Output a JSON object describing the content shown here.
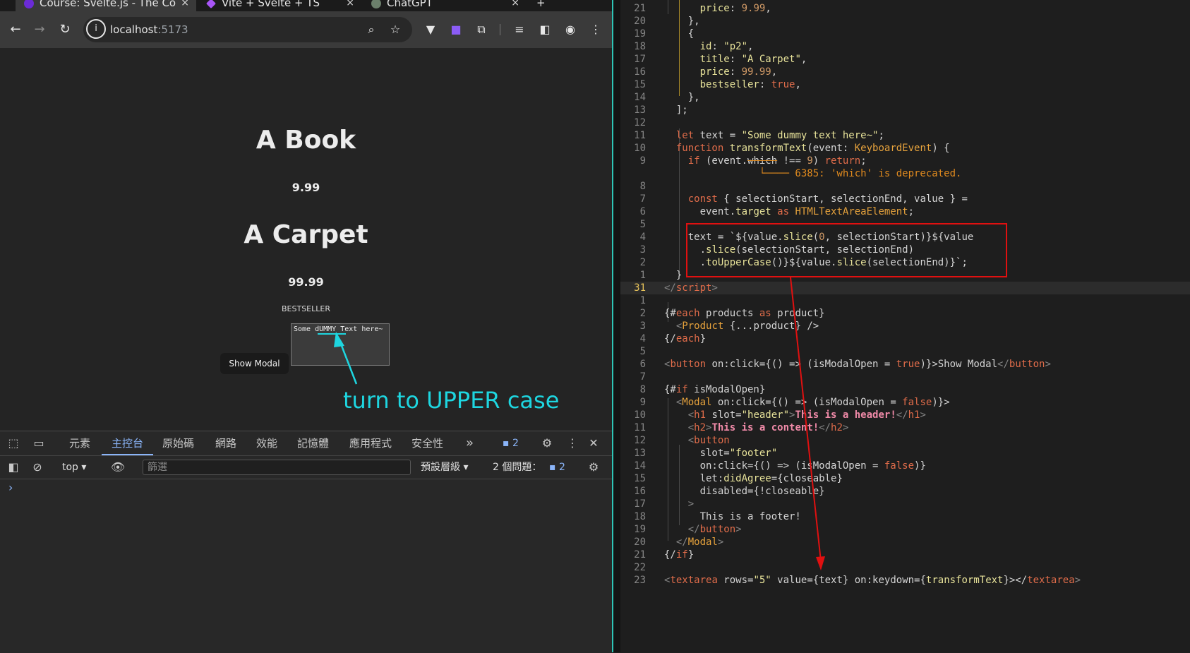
{
  "browser": {
    "tabs": [
      {
        "title": "Course: Svelte.js - The Co",
        "active": true,
        "favicon_color": "#6b2bd6"
      },
      {
        "title": "Vite + Svelte + TS",
        "active": false,
        "favicon_color": "#a855f7"
      },
      {
        "title": "ChatGPT",
        "active": false,
        "favicon_color": "#6b7f6b"
      }
    ],
    "close_glyph": "×",
    "new_tab_glyph": "+",
    "url_host": "localhost",
    "url_port": ":5173",
    "info_glyph": "i"
  },
  "page": {
    "products": [
      {
        "title": "A Book",
        "price": "9.99"
      },
      {
        "title": "A Carpet",
        "price": "99.99",
        "badge": "BESTSELLER"
      }
    ],
    "textarea_value": "Some dUMMY Text here~",
    "show_modal_label": "Show Modal",
    "annotation": "turn to UPPER case",
    "annotation_color": "#1ed6e0"
  },
  "devtools": {
    "tabs": [
      "元素",
      "主控台",
      "原始碼",
      "網路",
      "效能",
      "記憶體",
      "應用程式",
      "安全性"
    ],
    "active_tab": "主控台",
    "more_glyph": "»",
    "issues_badge": "2",
    "context": "top",
    "filter_placeholder": "篩選",
    "levels": "預設層級",
    "issues_label": "2 個問題：",
    "issues_count": "2",
    "prompt": "›"
  },
  "editor": {
    "highlight_box_color": "#e01010",
    "lines": [
      {
        "n": "21",
        "segs": [
          [
            "      ",
            "#d4d4d4"
          ],
          [
            "price",
            "#e8e39a"
          ],
          [
            ": ",
            "#d4d4d4"
          ],
          [
            "9.99",
            "#d19a66"
          ],
          [
            ",",
            "#d4d4d4"
          ]
        ]
      },
      {
        "n": "20",
        "segs": [
          [
            "    },",
            "#d4d4d4"
          ]
        ]
      },
      {
        "n": "19",
        "segs": [
          [
            "    {",
            "#d4d4d4"
          ]
        ]
      },
      {
        "n": "18",
        "segs": [
          [
            "      ",
            "#d4d4d4"
          ],
          [
            "id",
            "#e8e39a"
          ],
          [
            ": ",
            "#d4d4d4"
          ],
          [
            "\"p2\"",
            "#e8e39a"
          ],
          [
            ",",
            "#d4d4d4"
          ]
        ]
      },
      {
        "n": "17",
        "segs": [
          [
            "      ",
            "#d4d4d4"
          ],
          [
            "title",
            "#e8e39a"
          ],
          [
            ": ",
            "#d4d4d4"
          ],
          [
            "\"A Carpet\"",
            "#e8e39a"
          ],
          [
            ",",
            "#d4d4d4"
          ]
        ]
      },
      {
        "n": "16",
        "segs": [
          [
            "      ",
            "#d4d4d4"
          ],
          [
            "price",
            "#e8e39a"
          ],
          [
            ": ",
            "#d4d4d4"
          ],
          [
            "99.99",
            "#d19a66"
          ],
          [
            ",",
            "#d4d4d4"
          ]
        ]
      },
      {
        "n": "15",
        "segs": [
          [
            "      ",
            "#d4d4d4"
          ],
          [
            "bestseller",
            "#e8e39a"
          ],
          [
            ": ",
            "#d4d4d4"
          ],
          [
            "true",
            "#e06c4a"
          ],
          [
            ",",
            "#d4d4d4"
          ]
        ]
      },
      {
        "n": "14",
        "segs": [
          [
            "    },",
            "#d4d4d4"
          ]
        ]
      },
      {
        "n": "13",
        "segs": [
          [
            "  ];",
            "#d4d4d4"
          ]
        ]
      },
      {
        "n": "12",
        "segs": [
          [
            "",
            "#d4d4d4"
          ]
        ]
      },
      {
        "n": "11",
        "segs": [
          [
            "  ",
            "#d4d4d4"
          ],
          [
            "let",
            "#e06c4a"
          ],
          [
            " text = ",
            "#d4d4d4"
          ],
          [
            "\"Some dummy text here~\"",
            "#e8e39a"
          ],
          [
            ";",
            "#d4d4d4"
          ]
        ]
      },
      {
        "n": "10",
        "segs": [
          [
            "  ",
            "#d4d4d4"
          ],
          [
            "function",
            "#e06c4a"
          ],
          [
            " ",
            "#d4d4d4"
          ],
          [
            "transformText",
            "#e8e39a"
          ],
          [
            "(event: ",
            "#d4d4d4"
          ],
          [
            "KeyboardEvent",
            "#e6a23c"
          ],
          [
            ") {",
            "#d4d4d4"
          ]
        ]
      },
      {
        "n": "9",
        "segs": [
          [
            "    ",
            "#d4d4d4"
          ],
          [
            "if",
            "#e06c4a"
          ],
          [
            " (event.",
            "#d4d4d4"
          ],
          [
            "which",
            "#d4d4d4"
          ],
          [
            " !== ",
            "#d4d4d4"
          ],
          [
            "9",
            "#d19a66"
          ],
          [
            ") ",
            "#d4d4d4"
          ],
          [
            "return",
            "#e06c4a"
          ],
          [
            ";",
            "#d4d4d4"
          ]
        ]
      },
      {
        "n": "",
        "segs": [
          [
            "                ",
            "#d4d4d4"
          ],
          [
            "└──── 6385: 'which' is deprecated.",
            "#e08a1e"
          ]
        ]
      },
      {
        "n": "8",
        "segs": [
          [
            "",
            "#d4d4d4"
          ]
        ]
      },
      {
        "n": "7",
        "segs": [
          [
            "    ",
            "#d4d4d4"
          ],
          [
            "const",
            "#e06c4a"
          ],
          [
            " { selectionStart, selectionEnd, value } =",
            "#d4d4d4"
          ]
        ]
      },
      {
        "n": "6",
        "segs": [
          [
            "      event.",
            "#d4d4d4"
          ],
          [
            "target",
            "#e8e39a"
          ],
          [
            " ",
            "#d4d4d4"
          ],
          [
            "as",
            "#e06c4a"
          ],
          [
            " ",
            "#d4d4d4"
          ],
          [
            "HTMLTextAreaElement",
            "#e6a23c"
          ],
          [
            ";",
            "#d4d4d4"
          ]
        ]
      },
      {
        "n": "5",
        "segs": [
          [
            "",
            "#d4d4d4"
          ]
        ]
      },
      {
        "n": "4",
        "segs": [
          [
            "    text = `${value.",
            "#d4d4d4"
          ],
          [
            "slice",
            "#e8e39a"
          ],
          [
            "(",
            "#d4d4d4"
          ],
          [
            "0",
            "#d19a66"
          ],
          [
            ", selectionStart)}${value",
            "#d4d4d4"
          ]
        ]
      },
      {
        "n": "3",
        "segs": [
          [
            "      .",
            "#d4d4d4"
          ],
          [
            "slice",
            "#e8e39a"
          ],
          [
            "(selectionStart, selectionEnd)",
            "#d4d4d4"
          ]
        ]
      },
      {
        "n": "2",
        "segs": [
          [
            "      .",
            "#d4d4d4"
          ],
          [
            "toUpperCase",
            "#e8e39a"
          ],
          [
            "()}${value.",
            "#d4d4d4"
          ],
          [
            "slice",
            "#e8e39a"
          ],
          [
            "(selectionEnd)}`;",
            "#d4d4d4"
          ]
        ]
      },
      {
        "n": "1",
        "segs": [
          [
            "  }",
            "#d4d4d4"
          ]
        ]
      },
      {
        "n": "31",
        "segs": [
          [
            "</",
            "#858585"
          ],
          [
            "script",
            "#e06c4a"
          ],
          [
            ">",
            "#858585"
          ]
        ],
        "current": true
      },
      {
        "n": "1",
        "segs": [
          [
            "",
            "#d4d4d4"
          ]
        ]
      },
      {
        "n": "2",
        "segs": [
          [
            "{#",
            "#d4d4d4"
          ],
          [
            "each",
            "#e06c4a"
          ],
          [
            " products ",
            "#d4d4d4"
          ],
          [
            "as",
            "#e06c4a"
          ],
          [
            " product}",
            "#d4d4d4"
          ]
        ]
      },
      {
        "n": "3",
        "segs": [
          [
            "  <",
            "#858585"
          ],
          [
            "Product",
            "#e6a23c"
          ],
          [
            " {...product} />",
            "#d4d4d4"
          ]
        ]
      },
      {
        "n": "4",
        "segs": [
          [
            "{/",
            "#d4d4d4"
          ],
          [
            "each",
            "#e06c4a"
          ],
          [
            "}",
            "#d4d4d4"
          ]
        ]
      },
      {
        "n": "5",
        "segs": [
          [
            "",
            "#d4d4d4"
          ]
        ]
      },
      {
        "n": "6",
        "segs": [
          [
            "<",
            "#858585"
          ],
          [
            "button",
            "#e06c4a"
          ],
          [
            " on:click={() => (isModalOpen = ",
            "#d4d4d4"
          ],
          [
            "true",
            "#e06c4a"
          ],
          [
            ")}>",
            "#d4d4d4"
          ],
          [
            "Show Modal",
            "#d4d4d4"
          ],
          [
            "</",
            "#858585"
          ],
          [
            "button",
            "#e06c4a"
          ],
          [
            ">",
            "#858585"
          ]
        ]
      },
      {
        "n": "7",
        "segs": [
          [
            "",
            "#d4d4d4"
          ]
        ]
      },
      {
        "n": "8",
        "segs": [
          [
            "{#",
            "#d4d4d4"
          ],
          [
            "if",
            "#e06c4a"
          ],
          [
            " isModalOpen}",
            "#d4d4d4"
          ]
        ]
      },
      {
        "n": "9",
        "segs": [
          [
            "  <",
            "#858585"
          ],
          [
            "Modal",
            "#e6a23c"
          ],
          [
            " on:click={() => (isModalOpen = ",
            "#d4d4d4"
          ],
          [
            "false",
            "#e06c4a"
          ],
          [
            ")}>",
            "#d4d4d4"
          ]
        ]
      },
      {
        "n": "10",
        "segs": [
          [
            "    <",
            "#858585"
          ],
          [
            "h1",
            "#e06c4a"
          ],
          [
            " slot=",
            "#d4d4d4"
          ],
          [
            "\"header\"",
            "#e8e39a"
          ],
          [
            ">",
            "#858585"
          ],
          [
            "This is a header!",
            "#f08aa8"
          ],
          [
            "</",
            "#858585"
          ],
          [
            "h1",
            "#e06c4a"
          ],
          [
            ">",
            "#858585"
          ]
        ]
      },
      {
        "n": "11",
        "segs": [
          [
            "    <",
            "#858585"
          ],
          [
            "h2",
            "#e06c4a"
          ],
          [
            ">",
            "#858585"
          ],
          [
            "This is a content!",
            "#f08aa8"
          ],
          [
            "</",
            "#858585"
          ],
          [
            "h2",
            "#e06c4a"
          ],
          [
            ">",
            "#858585"
          ]
        ]
      },
      {
        "n": "12",
        "segs": [
          [
            "    <",
            "#858585"
          ],
          [
            "button",
            "#e06c4a"
          ]
        ]
      },
      {
        "n": "13",
        "segs": [
          [
            "      slot=",
            "#d4d4d4"
          ],
          [
            "\"footer\"",
            "#e8e39a"
          ]
        ]
      },
      {
        "n": "14",
        "segs": [
          [
            "      on:click={() => (isModalOpen = ",
            "#d4d4d4"
          ],
          [
            "false",
            "#e06c4a"
          ],
          [
            ")}",
            "#d4d4d4"
          ]
        ]
      },
      {
        "n": "15",
        "segs": [
          [
            "      let:",
            "#d4d4d4"
          ],
          [
            "didAgree",
            "#e8e39a"
          ],
          [
            "={closeable}",
            "#d4d4d4"
          ]
        ]
      },
      {
        "n": "16",
        "segs": [
          [
            "      disabled={!closeable}",
            "#d4d4d4"
          ]
        ]
      },
      {
        "n": "17",
        "segs": [
          [
            "    >",
            "#858585"
          ]
        ]
      },
      {
        "n": "18",
        "segs": [
          [
            "      This is a footer!",
            "#d4d4d4"
          ]
        ]
      },
      {
        "n": "19",
        "segs": [
          [
            "    </",
            "#858585"
          ],
          [
            "button",
            "#e06c4a"
          ],
          [
            ">",
            "#858585"
          ]
        ]
      },
      {
        "n": "20",
        "segs": [
          [
            "  </",
            "#858585"
          ],
          [
            "Modal",
            "#e6a23c"
          ],
          [
            ">",
            "#858585"
          ]
        ]
      },
      {
        "n": "21",
        "segs": [
          [
            "{/",
            "#d4d4d4"
          ],
          [
            "if",
            "#e06c4a"
          ],
          [
            "}",
            "#d4d4d4"
          ]
        ]
      },
      {
        "n": "22",
        "segs": [
          [
            "",
            "#d4d4d4"
          ]
        ]
      },
      {
        "n": "23",
        "segs": [
          [
            "<",
            "#858585"
          ],
          [
            "textarea",
            "#e06c4a"
          ],
          [
            " rows=",
            "#d4d4d4"
          ],
          [
            "\"5\"",
            "#e8e39a"
          ],
          [
            " value={text} on:keydown={",
            "#d4d4d4"
          ],
          [
            "transformText",
            "#e8e39a"
          ],
          [
            "}></",
            "#d4d4d4"
          ],
          [
            "textarea",
            "#e06c4a"
          ],
          [
            ">",
            "#858585"
          ]
        ]
      }
    ]
  }
}
